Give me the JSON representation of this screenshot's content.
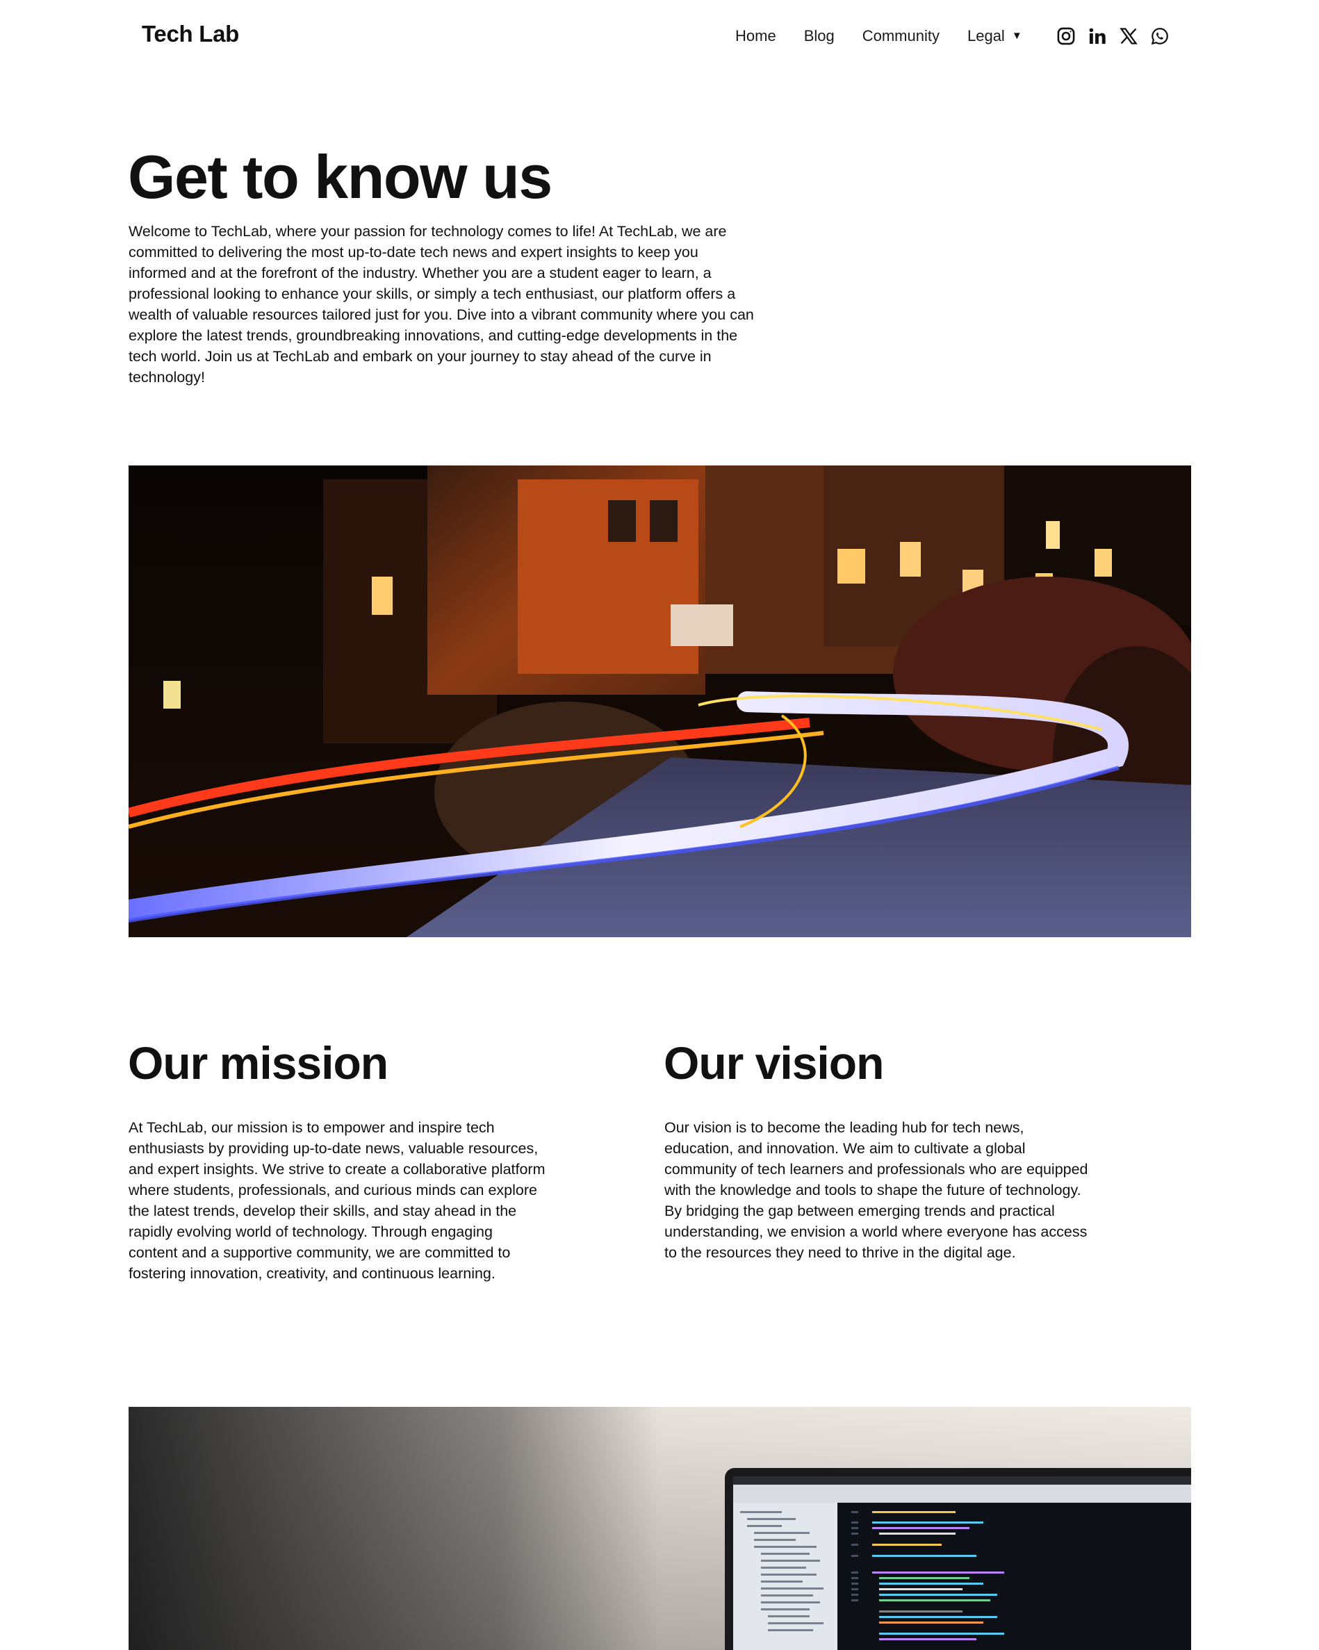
{
  "header": {
    "brand": "Tech Lab",
    "nav": [
      {
        "label": "Home"
      },
      {
        "label": "Blog"
      },
      {
        "label": "Community"
      },
      {
        "label": "Legal"
      }
    ],
    "social_icons": [
      "instagram-icon",
      "linkedin-icon",
      "x-icon",
      "whatsapp-icon"
    ]
  },
  "hero": {
    "title": "Get to know us",
    "text": "Welcome to TechLab, where your passion for technology comes to life! At TechLab, we are committed to delivering the most up-to-date tech news and expert insights to keep you informed and at the forefront of the industry. Whether you are a student eager to learn, a professional looking to enhance your skills, or simply a tech enthusiast, our platform offers a wealth of valuable resources tailored just for you. Dive into a vibrant community where you can explore the latest trends, groundbreaking innovations, and cutting-edge developments in the tech world. Join us at TechLab and embark on your journey to stay ahead of the curve in technology!"
  },
  "mission": {
    "title": "Our mission",
    "text": "At TechLab, our mission is to empower and inspire tech enthusiasts by providing up-to-date news, valuable resources, and expert insights. We strive to create a collaborative platform where students, professionals, and curious minds can explore the latest trends, develop their skills, and stay ahead in the rapidly evolving world of technology. Through engaging content and a supportive community, we are committed to fostering innovation, creativity, and continuous learning."
  },
  "vision": {
    "title": "Our vision",
    "text": "Our vision is to become the leading hub for tech news, education, and innovation. We aim to cultivate a global community of tech learners and professionals who are equipped with the knowledge and tools to shape the future of technology. By bridging the gap between emerging trends and practical understanding, we envision a world where everyone has access to the resources they need to thrive in the digital age."
  },
  "colors": {
    "text": "#111111",
    "background": "#ffffff"
  }
}
